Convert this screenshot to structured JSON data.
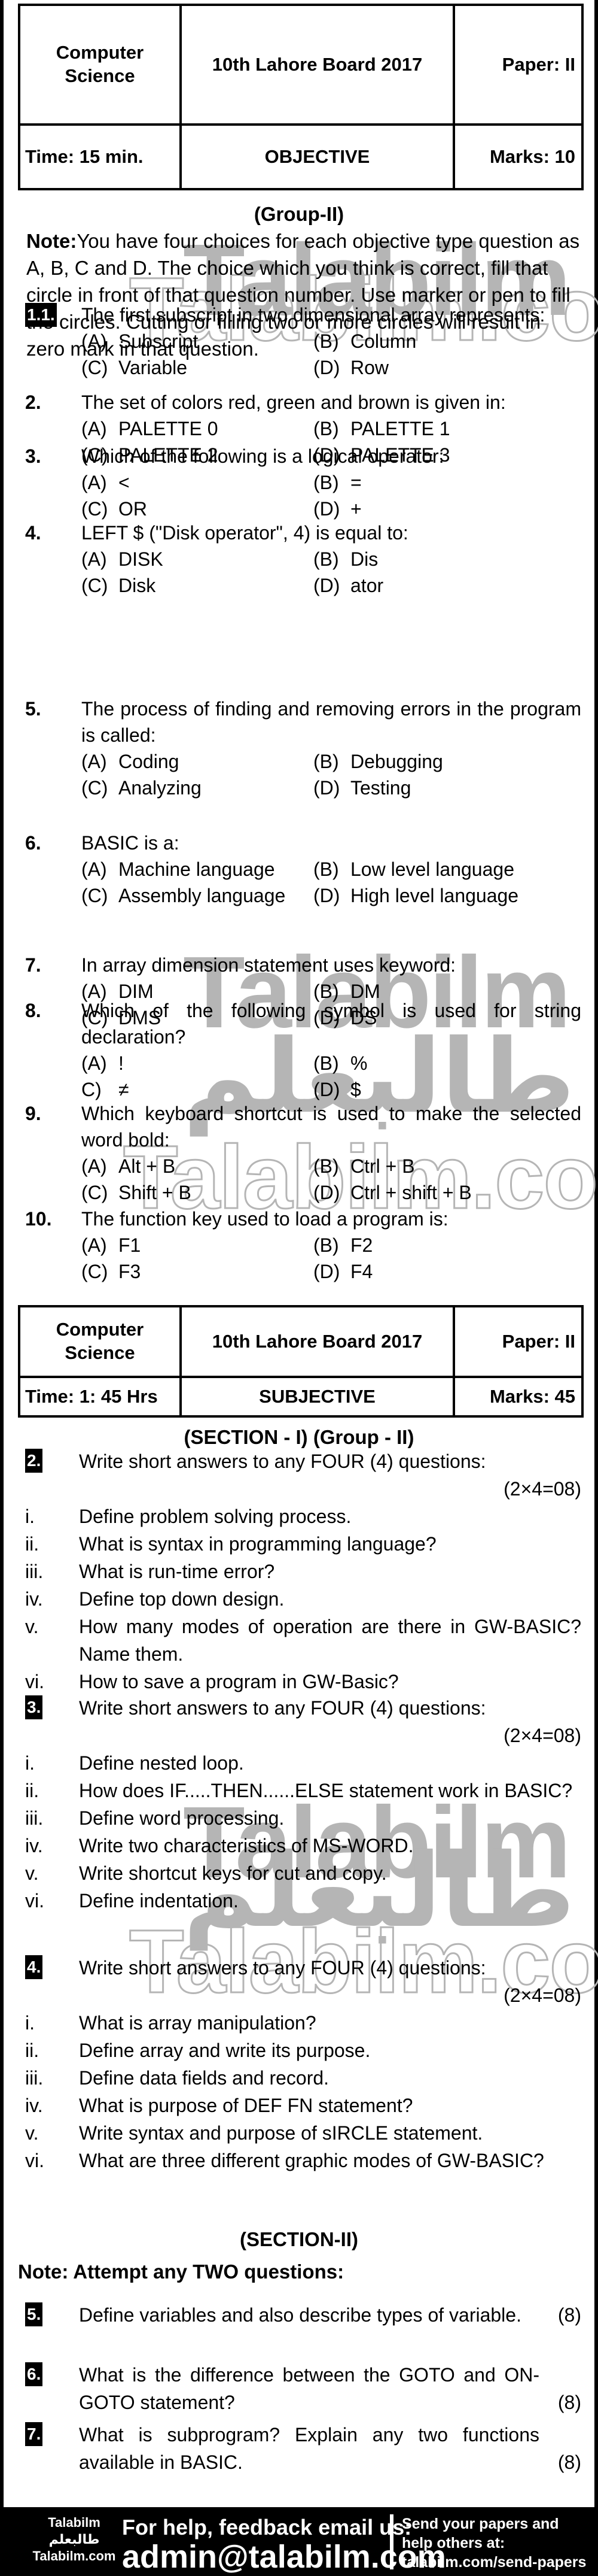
{
  "watermark": {
    "en": "Talabilm",
    "dotcom": "Talabilm.com",
    "urdu": "طالبعلم"
  },
  "objective_header": {
    "subject": "Computer Science",
    "board": "10th Lahore Board 2017",
    "paper": "Paper: II",
    "time": "Time: 15 min.",
    "section": "OBJECTIVE",
    "marks": "Marks: 10"
  },
  "objective": {
    "group": "(Group-II)",
    "note_label": "Note:",
    "note_text": "You have four choices for each objective type question as A, B, C and D. The choice which you think is correct, fill that circle in front of that question number. Use marker or pen to fill the circles. Cutting or filling two or more circles will result in zero mark in that question.",
    "questions": [
      {
        "num": "1.1.",
        "text": "The first subscript in two dimensional array represents:",
        "options": [
          {
            "label": "(A)",
            "text": "Subscript"
          },
          {
            "label": "(B)",
            "text": "Column"
          },
          {
            "label": "(C)",
            "text": "Variable"
          },
          {
            "label": "(D)",
            "text": "Row"
          }
        ]
      },
      {
        "num": "2.",
        "text": "The set of colors red, green and brown is given in:",
        "options": [
          {
            "label": "(A)",
            "text": "PALETTE 0"
          },
          {
            "label": "(B)",
            "text": "PALETTE 1"
          },
          {
            "label": "(C)",
            "text": "PALETTE 2"
          },
          {
            "label": "(D)",
            "text": "PALETTE 3"
          }
        ]
      },
      {
        "num": "3.",
        "text": "Which of the following is a logical operator:",
        "options": [
          {
            "label": "(A)",
            "text": "<"
          },
          {
            "label": "(B)",
            "text": "="
          },
          {
            "label": "(C)",
            "text": "OR"
          },
          {
            "label": "(D)",
            "text": "+"
          }
        ]
      },
      {
        "num": "4.",
        "text": "LEFT $ (\"Disk operator\", 4) is equal to:",
        "options": [
          {
            "label": "(A)",
            "text": "DISK"
          },
          {
            "label": "(B)",
            "text": "Dis"
          },
          {
            "label": "(C)",
            "text": "Disk"
          },
          {
            "label": "(D)",
            "text": "ator"
          }
        ]
      },
      {
        "num": "5.",
        "text": "The process of finding and removing errors in the program is called:",
        "options": [
          {
            "label": "(A)",
            "text": "Coding"
          },
          {
            "label": "(B)",
            "text": "Debugging"
          },
          {
            "label": "(C)",
            "text": "Analyzing"
          },
          {
            "label": "(D)",
            "text": "Testing"
          }
        ]
      },
      {
        "num": "6.",
        "text": "BASIC is a:",
        "options": [
          {
            "label": "(A)",
            "text": "Machine language"
          },
          {
            "label": "(B)",
            "text": "Low level language"
          },
          {
            "label": "(C)",
            "text": "Assembly language"
          },
          {
            "label": "(D)",
            "text": "High level language"
          }
        ]
      },
      {
        "num": "7.",
        "text": "In array dimension statement uses keyword:",
        "options": [
          {
            "label": "(A)",
            "text": "DIM"
          },
          {
            "label": "(B)",
            "text": "DM"
          },
          {
            "label": "(C)",
            "text": "DMS"
          },
          {
            "label": "(D)",
            "text": "DS"
          }
        ]
      },
      {
        "num": "8.",
        "text": "Which of the following symbol is used for string declaration?",
        "options": [
          {
            "label": "(A)",
            "text": "!"
          },
          {
            "label": "(B)",
            "text": "%"
          },
          {
            "label": "C)",
            "text": "≠"
          },
          {
            "label": "(D)",
            "text": "$"
          }
        ]
      },
      {
        "num": "9.",
        "text": "Which keyboard shortcut is used to make the selected word bold:",
        "options": [
          {
            "label": "(A)",
            "text": "Alt + B"
          },
          {
            "label": "(B)",
            "text": "Ctrl + B"
          },
          {
            "label": "(C)",
            "text": "Shift + B"
          },
          {
            "label": "(D)",
            "text": "Ctrl + shift + B"
          }
        ]
      },
      {
        "num": "10.",
        "text": "The function key used to load a program is:",
        "options": [
          {
            "label": "(A)",
            "text": "F1"
          },
          {
            "label": "(B)",
            "text": "F2"
          },
          {
            "label": "(C)",
            "text": "F3"
          },
          {
            "label": "(D)",
            "text": "F4"
          }
        ]
      }
    ]
  },
  "subjective_header": {
    "subject": "Computer Science",
    "board": "10th Lahore Board 2017",
    "paper": "Paper: II",
    "time": "Time: 1: 45 Hrs",
    "section": "SUBJECTIVE",
    "marks": "Marks: 45"
  },
  "section1": {
    "title": "(SECTION - I) (Group - II)",
    "blocks": [
      {
        "num": "2.",
        "instruction": "Write short answers to any FOUR (4) questions:",
        "marks": "(2×4=08)",
        "items": [
          {
            "n": "i.",
            "t": "Define problem solving process."
          },
          {
            "n": "ii.",
            "t": "What is syntax in programming language?"
          },
          {
            "n": "iii.",
            "t": "What is run-time error?"
          },
          {
            "n": "iv.",
            "t": "Define top down design."
          },
          {
            "n": "v.",
            "t": "How many modes of operation are there in GW-BASIC? Name them."
          },
          {
            "n": "vi.",
            "t": "How to save a program in GW-Basic?"
          }
        ]
      },
      {
        "num": "3.",
        "instruction": "Write short answers to any FOUR (4) questions:",
        "marks": "(2×4=08)",
        "items": [
          {
            "n": "i.",
            "t": "Define nested loop."
          },
          {
            "n": "ii.",
            "t": "How does IF.....THEN......ELSE statement work in BASIC?"
          },
          {
            "n": "iii.",
            "t": "Define word processing."
          },
          {
            "n": "iv.",
            "t": "Write two characteristics of MS-WORD."
          },
          {
            "n": "v.",
            "t": "Write shortcut keys for cut and copy."
          },
          {
            "n": "vi.",
            "t": "Define indentation."
          }
        ]
      },
      {
        "num": "4.",
        "instruction": "Write short answers to any FOUR (4) questions:",
        "marks": "(2×4=08)",
        "items": [
          {
            "n": "i.",
            "t": "What is array manipulation?"
          },
          {
            "n": "ii.",
            "t": "Define array and write its purpose."
          },
          {
            "n": "iii.",
            "t": "Define data fields and record."
          },
          {
            "n": "iv.",
            "t": "What is purpose of DEF FN statement?"
          },
          {
            "n": "v.",
            "t": "Write syntax and purpose of sIRCLE statement."
          },
          {
            "n": "vi.",
            "t": "What are three different graphic modes of GW-BASIC?"
          }
        ]
      }
    ]
  },
  "section2": {
    "title": "(SECTION-II)",
    "note": "Note: Attempt any TWO questions:",
    "questions": [
      {
        "num": "5.",
        "text": "Define variables and also describe types of variable.",
        "marks": "(8)"
      },
      {
        "num": "6.",
        "text": "What is the difference between the GOTO and ON-GOTO statement?",
        "marks": "(8)"
      },
      {
        "num": "7.",
        "text": "What is subprogram? Explain any two functions available in BASIC.",
        "marks": "(8)"
      }
    ]
  },
  "footer": {
    "brand_en": "Talabilm",
    "brand_ur": "طالبعلم",
    "brand_site": "Talabilm.com",
    "help_text": "For help, feedback email us:",
    "email": "admin@talabilm.com",
    "send_text": "Send your papers and help others at:",
    "send_url": "talabilm.com/send-papers"
  }
}
